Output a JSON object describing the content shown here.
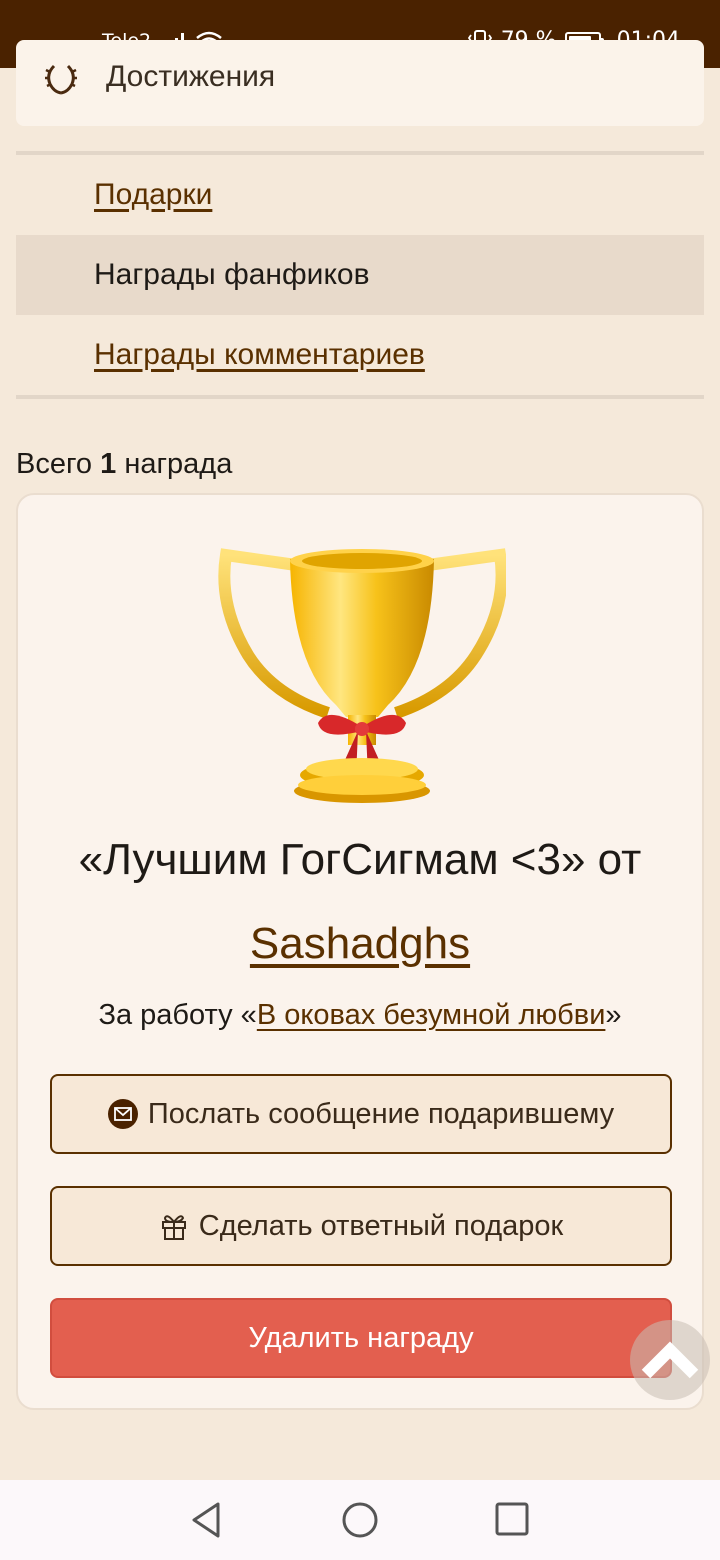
{
  "status_bar": {
    "carrier": "Tele2",
    "battery_percent": "79 %",
    "battery_level": 0.79,
    "time": "01:04",
    "icons": [
      "signal-icon",
      "wifi-icon",
      "vibrate-icon",
      "battery-icon"
    ]
  },
  "achievements": {
    "label": "Достижения",
    "icon": "laurel-wreath-icon"
  },
  "subnav": {
    "items": [
      {
        "label": "Подарки",
        "active": false
      },
      {
        "label": "Награды фанфиков",
        "active": true
      },
      {
        "label": "Награды комментариев",
        "active": false
      }
    ]
  },
  "summary": {
    "prefix": "Всего",
    "count": "1",
    "suffix": "награда"
  },
  "award": {
    "image": "trophy-cup-icon",
    "title": "«Лучшим ГогСигмам <3» от",
    "giver": "Sashadghs",
    "work_prefix": "За работу «",
    "work_title": "В оковах безумной любви",
    "work_suffix": "»"
  },
  "buttons": {
    "message": "Послать сообщение подарившему",
    "gift": "Сделать ответный подарок",
    "delete": "Удалить награду"
  },
  "colors": {
    "status_bar": "#4a2200",
    "background": "#f5e9da",
    "link": "#5a3000",
    "delete_button": "#e35f4f"
  }
}
